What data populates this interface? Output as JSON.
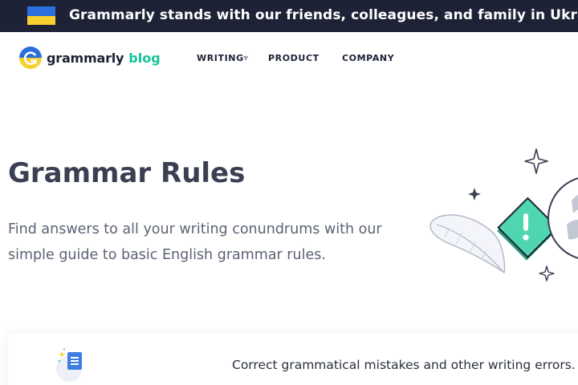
{
  "banner": {
    "text": "Grammarly stands with our friends, colleagues, and family in Ukraine, and with all people of Ukraine",
    "flag_colors": [
      "#2a6fdb",
      "#f7cf2e"
    ],
    "background": "#1d2236"
  },
  "nav": {
    "logo_word": "grammarly",
    "logo_blog": "blog",
    "items": [
      {
        "label": "WRITING",
        "has_dropdown": true
      },
      {
        "label": "PRODUCT"
      },
      {
        "label": "COMPANY"
      }
    ]
  },
  "hero": {
    "title": "Grammar Rules",
    "subtitle": "Find answers to all your writing conundrums with our simple guide to basic English grammar rules.",
    "illustration_icon": "feather-exclamation-sparkle-icon",
    "accent_color": "#4fd6b0"
  },
  "promo_card": {
    "text": "Correct grammatical mistakes and other writing errors.",
    "icon": "document-sparkle-icon"
  }
}
